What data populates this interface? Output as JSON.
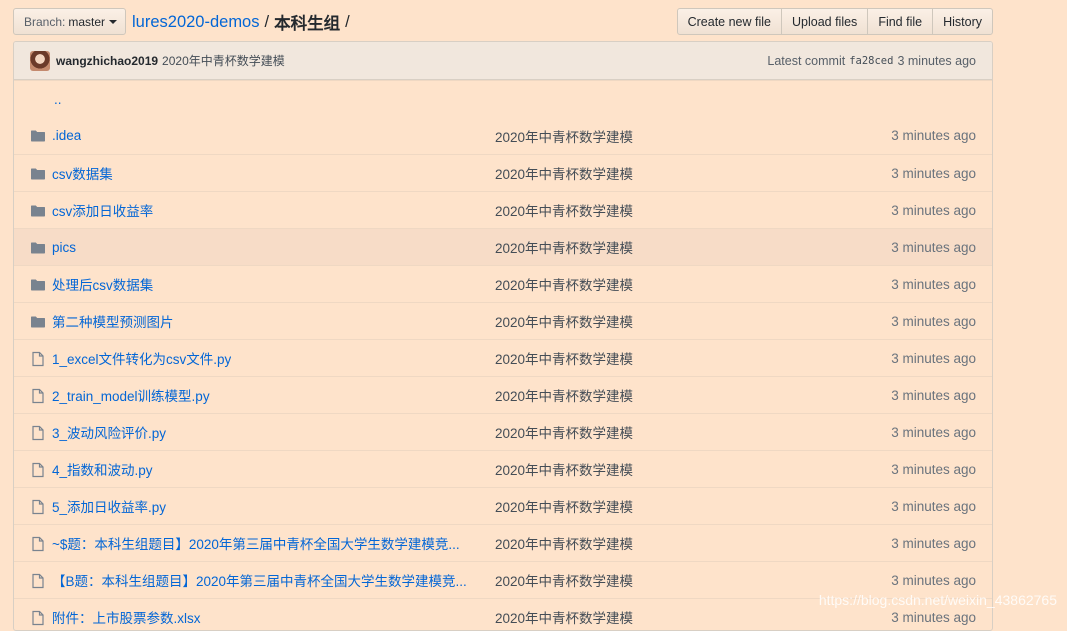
{
  "branch": {
    "label": "Branch:",
    "value": "master"
  },
  "breadcrumb": {
    "repo": "lures2020-demos",
    "separator": "/",
    "folder": "本科生组",
    "trailing": "/"
  },
  "actions": [
    "Create new file",
    "Upload files",
    "Find file",
    "History"
  ],
  "commit": {
    "author": "wangzhichao2019",
    "message": "2020年中青杯数学建模",
    "latest_label": "Latest commit",
    "sha": "fa28ced",
    "time": "3 minutes ago"
  },
  "parent_link": "..",
  "files": [
    {
      "type": "folder",
      "name": ".idea",
      "message": "2020年中青杯数学建模",
      "age": "3 minutes ago"
    },
    {
      "type": "folder",
      "name": "csv数据集",
      "message": "2020年中青杯数学建模",
      "age": "3 minutes ago"
    },
    {
      "type": "folder",
      "name": "csv添加日收益率",
      "message": "2020年中青杯数学建模",
      "age": "3 minutes ago"
    },
    {
      "type": "folder",
      "name": "pics",
      "message": "2020年中青杯数学建模",
      "age": "3 minutes ago"
    },
    {
      "type": "folder",
      "name": "处理后csv数据集",
      "message": "2020年中青杯数学建模",
      "age": "3 minutes ago"
    },
    {
      "type": "folder",
      "name": "第二种模型预测图片",
      "message": "2020年中青杯数学建模",
      "age": "3 minutes ago"
    },
    {
      "type": "file",
      "name": "1_excel文件转化为csv文件.py",
      "message": "2020年中青杯数学建模",
      "age": "3 minutes ago"
    },
    {
      "type": "file",
      "name": "2_train_model训练模型.py",
      "message": "2020年中青杯数学建模",
      "age": "3 minutes ago"
    },
    {
      "type": "file",
      "name": "3_波动风险评价.py",
      "message": "2020年中青杯数学建模",
      "age": "3 minutes ago"
    },
    {
      "type": "file",
      "name": "4_指数和波动.py",
      "message": "2020年中青杯数学建模",
      "age": "3 minutes ago"
    },
    {
      "type": "file",
      "name": "5_添加日收益率.py",
      "message": "2020年中青杯数学建模",
      "age": "3 minutes ago"
    },
    {
      "type": "file",
      "name": "~$题：本科生组题目】2020年第三届中青杯全国大学生数学建模竞...",
      "message": "2020年中青杯数学建模",
      "age": "3 minutes ago"
    },
    {
      "type": "file",
      "name": "【B题：本科生组题目】2020年第三届中青杯全国大学生数学建模竞...",
      "message": "2020年中青杯数学建模",
      "age": "3 minutes ago"
    },
    {
      "type": "file",
      "name": "附件：上市股票参数.xlsx",
      "message": "2020年中青杯数学建模",
      "age": "3 minutes ago"
    }
  ],
  "highlighted_row": "pics",
  "watermark": "https://blog.csdn.net/weixin_43862765",
  "colors": {
    "link": "#0366d6",
    "background": "#fee3cb",
    "icon": "#6a737d"
  }
}
